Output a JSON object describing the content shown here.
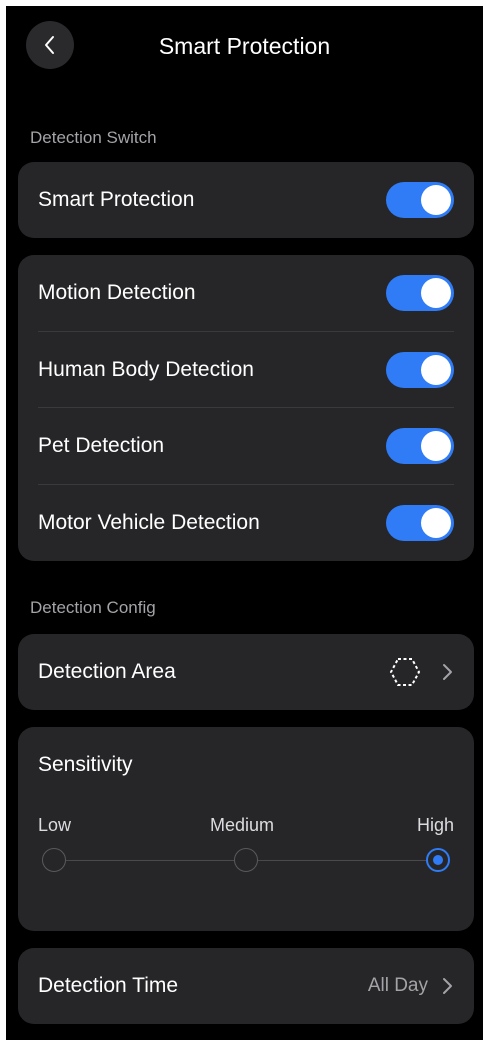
{
  "header": {
    "title": "Smart Protection",
    "back_icon": "chevron-left-icon"
  },
  "detection_switch": {
    "section_label": "Detection Switch",
    "master": {
      "label": "Smart Protection",
      "enabled": true
    },
    "items": [
      {
        "label": "Motion Detection",
        "enabled": true
      },
      {
        "label": "Human Body Detection",
        "enabled": true
      },
      {
        "label": "Pet Detection",
        "enabled": true
      },
      {
        "label": "Motor Vehicle Detection",
        "enabled": true
      }
    ]
  },
  "detection_config": {
    "section_label": "Detection Config",
    "area": {
      "label": "Detection Area",
      "icon": "hexagon-area-icon"
    },
    "sensitivity": {
      "title": "Sensitivity",
      "levels": [
        "Low",
        "Medium",
        "High"
      ],
      "selected": "High"
    },
    "time": {
      "label": "Detection Time",
      "value": "All Day"
    }
  },
  "colors": {
    "background": "#000000",
    "card": "#262628",
    "accent": "#2f7cf6",
    "secondary_text": "#a3a3a8"
  }
}
